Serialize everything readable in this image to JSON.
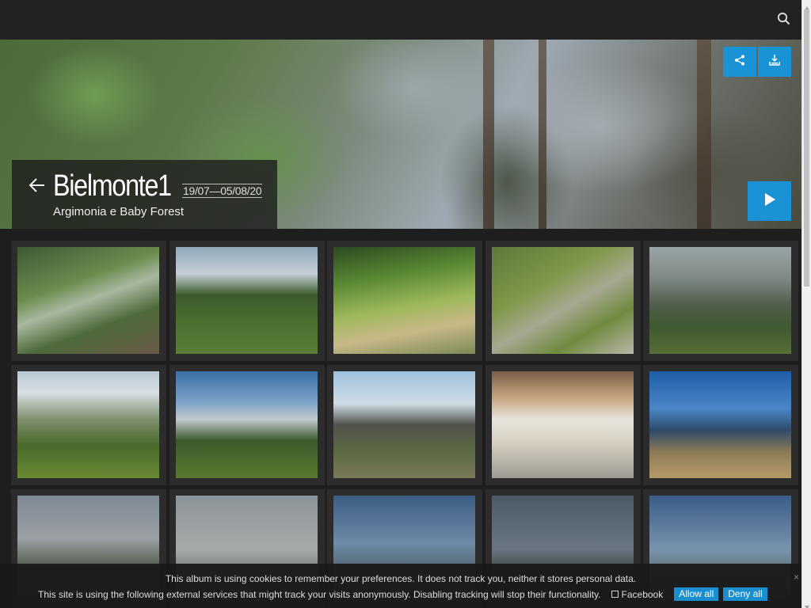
{
  "album": {
    "title": "Bielmonte1",
    "date_range": "19/07—05/08/20",
    "subtitle": "Argimonia e Baby Forest"
  },
  "icons": {
    "search": "search-icon",
    "share": "share-icon",
    "download": "download-icon",
    "back": "back-arrow-icon",
    "play": "play-icon"
  },
  "colors": {
    "accent": "#1a93d6",
    "topbar": "#222222",
    "background": "#1e1e1e",
    "thumb_frame": "#2c2c2c"
  },
  "thumbnails": [
    {
      "subject": "forest path with trees"
    },
    {
      "subject": "pine trees on grassy slope"
    },
    {
      "subject": "birch trees in sunlight"
    },
    {
      "subject": "grassy slope with rocks"
    },
    {
      "subject": "misty mountain valley"
    },
    {
      "subject": "sun behind trees on hillside"
    },
    {
      "subject": "fir tree under blue sky"
    },
    {
      "subject": "stone chapel on mountain"
    },
    {
      "subject": "memorial board with flowers"
    },
    {
      "subject": "blue mountain panorama"
    },
    {
      "subject": "mountain peak in haze"
    },
    {
      "subject": "hilltop at dusk"
    },
    {
      "subject": "mountain ridge blue sky"
    },
    {
      "subject": "trees silhouette"
    },
    {
      "subject": "valley panorama"
    }
  ],
  "cookie": {
    "line1": "This album is using cookies to remember your preferences. It does not track you, neither it stores personal data.",
    "line2": "This site is using the following external services that might track your visits anonymously. Disabling tracking will stop their functionality.",
    "facebook_label": "Facebook",
    "allow_label": "Allow all",
    "deny_label": "Deny all",
    "close_label": "×"
  }
}
